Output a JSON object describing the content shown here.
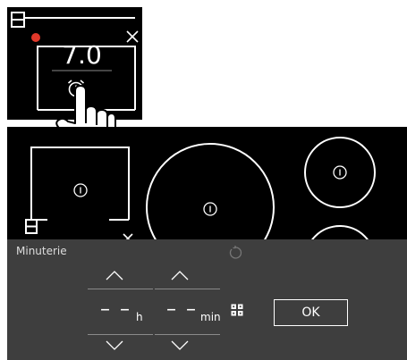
{
  "zoom_panel": {
    "power_value": "7.0",
    "icons": {
      "zone": "zone-selector-icon",
      "close": "close-icon",
      "timer": "alarm-clock-icon",
      "hand": "pointing-hand-icon"
    }
  },
  "cooktop": {
    "zones": [
      {
        "name": "front-left-zone",
        "label": "I"
      },
      {
        "name": "center-large-zone",
        "label": "I"
      },
      {
        "name": "back-right-zone",
        "label": "I"
      },
      {
        "name": "front-right-zone",
        "label": ""
      }
    ]
  },
  "timer_panel": {
    "title": "Minuterie",
    "hours_value": "– –",
    "hours_unit": "h",
    "minutes_value": "– –",
    "minutes_unit": "min",
    "ok_label": "OK"
  },
  "colors": {
    "indicator_red": "#e0382a",
    "panel_bg": "#3e3e3e",
    "background": "#000000"
  }
}
